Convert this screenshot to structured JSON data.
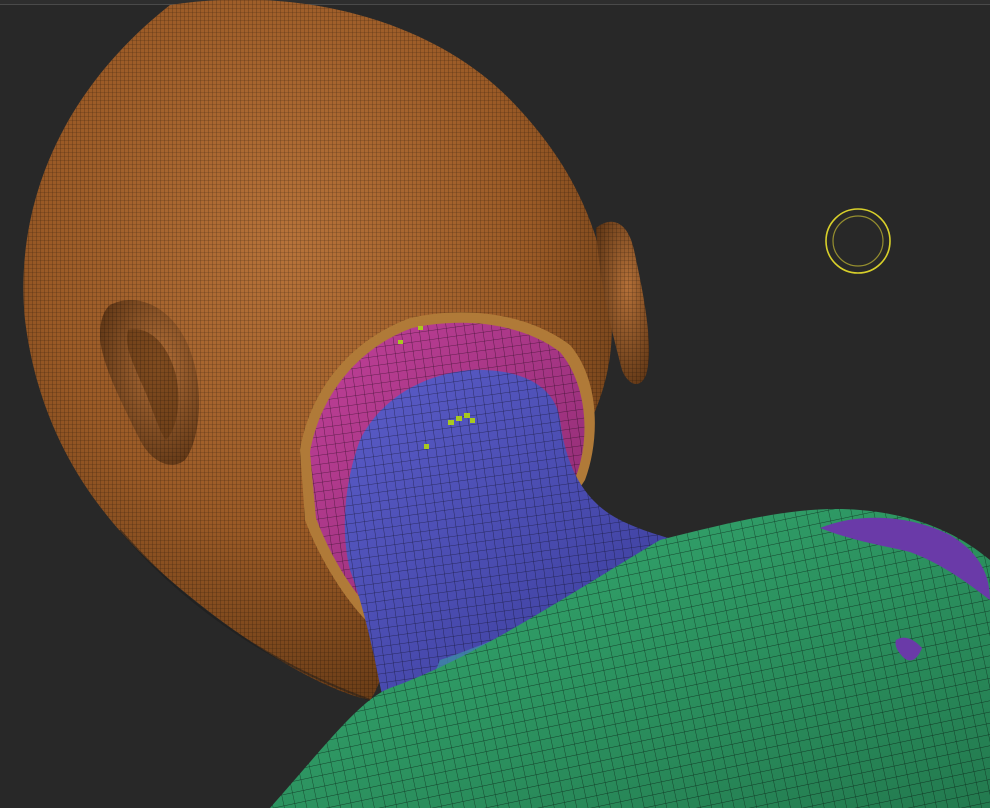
{
  "viewport": {
    "background": "#282828"
  },
  "model": {
    "polygroups": [
      {
        "name": "head",
        "color": "#a8652a"
      },
      {
        "name": "neck-back",
        "color": "#b0368d"
      },
      {
        "name": "neck",
        "color": "#4a4cb0"
      },
      {
        "name": "shoulders",
        "color": "#2f9e66"
      },
      {
        "name": "shoulder-patch",
        "color": "#6a3aa8"
      }
    ],
    "masked_highlight_color": "#a8c820",
    "wireframe_color": "#1a1a1a"
  },
  "brush_cursor": {
    "icon": "brush-draw-size-circle",
    "color": "#d8d02a"
  }
}
